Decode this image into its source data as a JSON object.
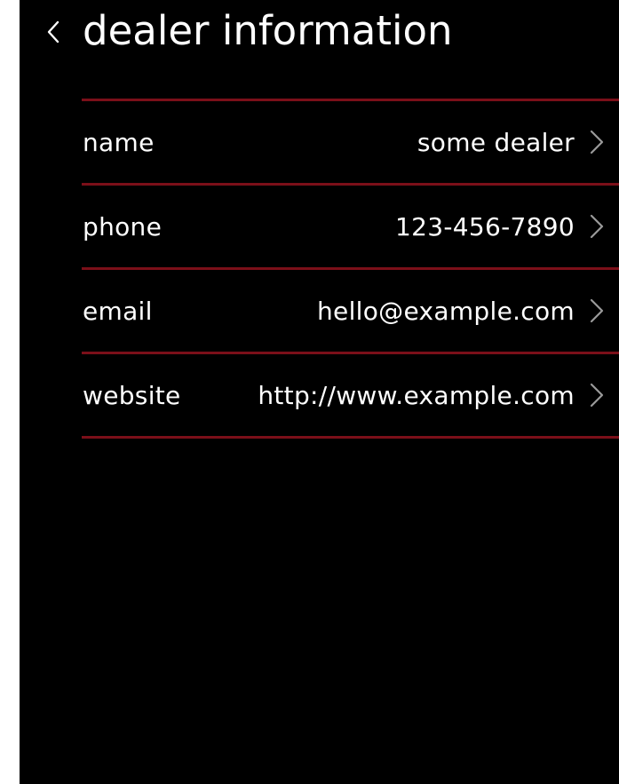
{
  "header": {
    "title": "dealer information",
    "back_icon": "chevron-left-icon"
  },
  "dealer": {
    "rows": [
      {
        "label": "name",
        "value": "some dealer",
        "icon": "chevron-right-icon"
      },
      {
        "label": "phone",
        "value": "123-456-7890",
        "icon": "chevron-right-icon"
      },
      {
        "label": "email",
        "value": "hello@example.com",
        "icon": "chevron-right-icon"
      },
      {
        "label": "website",
        "value": "http://www.example.com",
        "icon": "chevron-right-icon"
      }
    ]
  },
  "colors": {
    "background": "#000000",
    "text": "#ffffff",
    "divider": "#7b0f19",
    "chevron": "#9a9a9a",
    "outer": "#ffffff"
  }
}
